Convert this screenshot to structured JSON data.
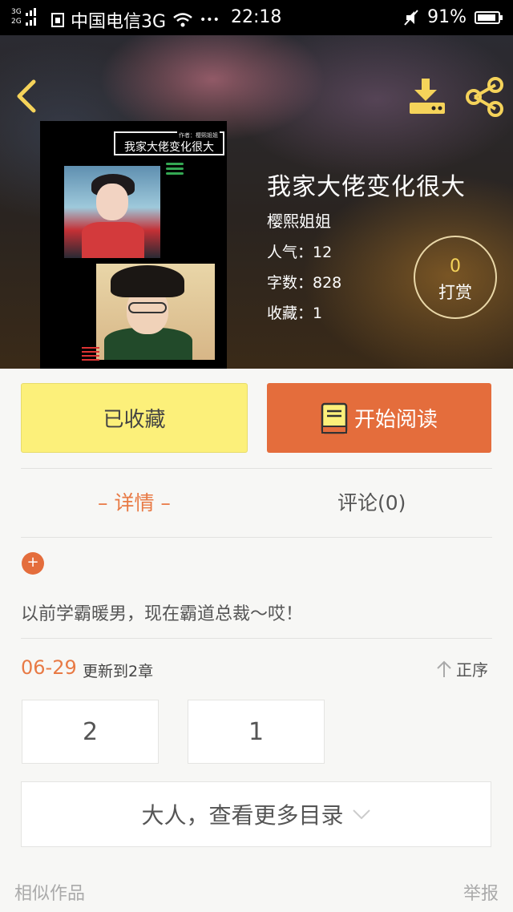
{
  "status_bar": {
    "signal_top": "3G",
    "signal_bottom": "2G",
    "carrier": "中国电信3G",
    "dots": "•••",
    "time": "22:18",
    "battery": "91%",
    "battery_level": 0.91
  },
  "header": {
    "icons": {
      "back": "back-arrow-icon",
      "download": "download-icon",
      "share": "share-icon"
    },
    "cover": {
      "author_line": "作者：樱熙姐姐",
      "title": "我家大佬变化很大"
    },
    "title": "我家大佬变化很大",
    "author": "樱熙姐姐",
    "popularity": "人气：12",
    "word_count": "字数：828",
    "favorites": "收藏：1",
    "tip_count": "0",
    "tip_label": "打赏"
  },
  "actions": {
    "favorite_label": "已收藏",
    "read_label": "开始阅读",
    "read_icon": "book-icon"
  },
  "tabs": {
    "detail": "– 详情 –",
    "comment": "评论(0)"
  },
  "detail": {
    "expand": "+",
    "description": "以前学霸暖男，现在霸道总裁～哎！"
  },
  "chapters": {
    "date": "06-29",
    "update_text": "更新到2章",
    "sort_label": "正序",
    "items": [
      "2",
      "1"
    ],
    "more_label": "大人，查看更多目录"
  },
  "footer": {
    "similar": "相似作品",
    "report": "举报"
  },
  "colors": {
    "accent": "#e46d3c",
    "favorite_bg": "#fcf07a",
    "tip_number": "#f5d35a"
  }
}
